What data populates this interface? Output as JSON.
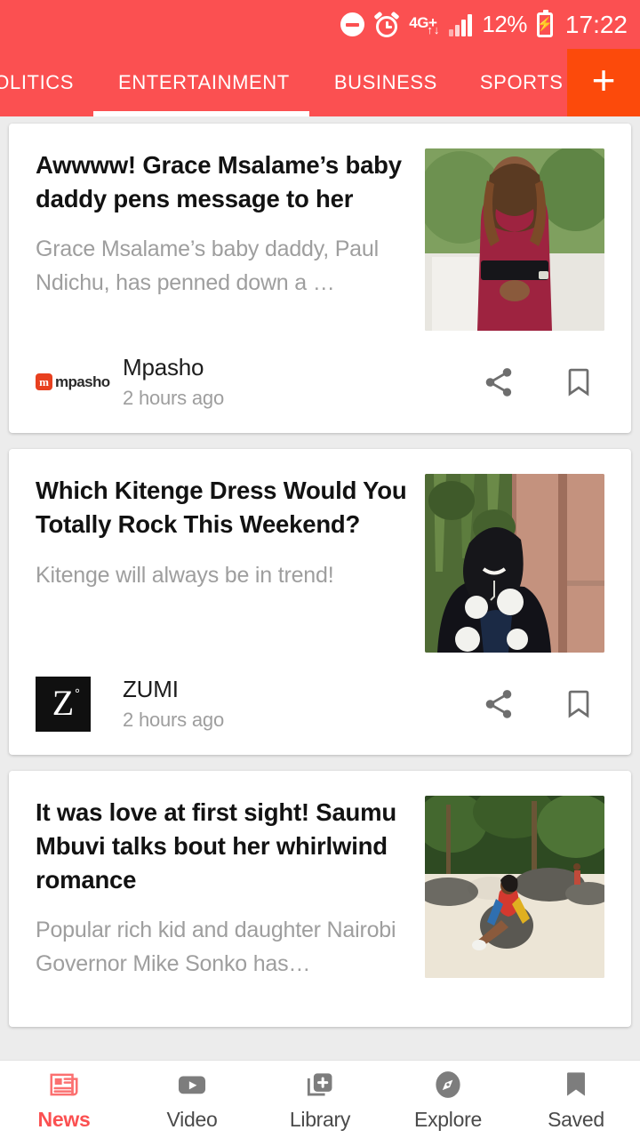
{
  "statusbar": {
    "dnd_icon": "do-not-disturb-icon",
    "alarm_icon": "alarm-clock-icon",
    "network_label": "4G+",
    "network_up": "↑",
    "network_down": "↓",
    "signal_icon": "signal-bars-icon",
    "battery_percent": "12%",
    "battery_icon": "battery-charging-icon",
    "battery_bolt": "⚡",
    "time": "17:22"
  },
  "tabs": {
    "items": [
      {
        "label": "POLITICS",
        "active": false
      },
      {
        "label": "ENTERTAINMENT",
        "active": true
      },
      {
        "label": "BUSINESS",
        "active": false
      },
      {
        "label": "SPORTS",
        "active": false
      }
    ],
    "add_label": "+",
    "accent_color": "#fb5051",
    "add_button_color": "#fc4a0b"
  },
  "articles": [
    {
      "headline": "Awwww! Grace Msalame’s baby daddy pens message to her",
      "summary": "Grace Msalame’s baby daddy, Paul Ndichu, has penned down a …",
      "publisher": "Mpasho",
      "publisher_logo": "mpasho-logo",
      "logo_mark": "m",
      "logo_wordmark": "mpasho",
      "time": "2 hours ago",
      "share_icon": "share-icon",
      "bookmark_icon": "bookmark-icon",
      "thumbnail": "woman-in-maroon-dress-photo"
    },
    {
      "headline": "Which Kitenge Dress Would You Totally Rock This Weekend?",
      "summary": "Kitenge will always be in trend!",
      "publisher": "ZUMI",
      "publisher_logo": "zumi-logo",
      "logo_mark": "Z",
      "logo_degree": "°",
      "time": "2 hours ago",
      "share_icon": "share-icon",
      "bookmark_icon": "bookmark-icon",
      "thumbnail": "smiling-woman-patterned-jacket-photo"
    },
    {
      "headline": "It was love at first sight! Saumu Mbuvi talks bout her whirlwind romance",
      "summary": "Popular rich kid and daughter Nairobi Governor Mike Sonko has…",
      "thumbnail": "woman-on-rock-at-beach-photo"
    }
  ],
  "bottomnav": {
    "items": [
      {
        "label": "News",
        "icon": "newspaper-icon",
        "active": true
      },
      {
        "label": "Video",
        "icon": "play-video-icon",
        "active": false
      },
      {
        "label": "Library",
        "icon": "library-add-icon",
        "active": false
      },
      {
        "label": "Explore",
        "icon": "compass-icon",
        "active": false
      },
      {
        "label": "Saved",
        "icon": "bookmark-filled-icon",
        "active": false
      }
    ],
    "active_color": "#fb5051",
    "inactive_color": "#7d7d7d"
  }
}
